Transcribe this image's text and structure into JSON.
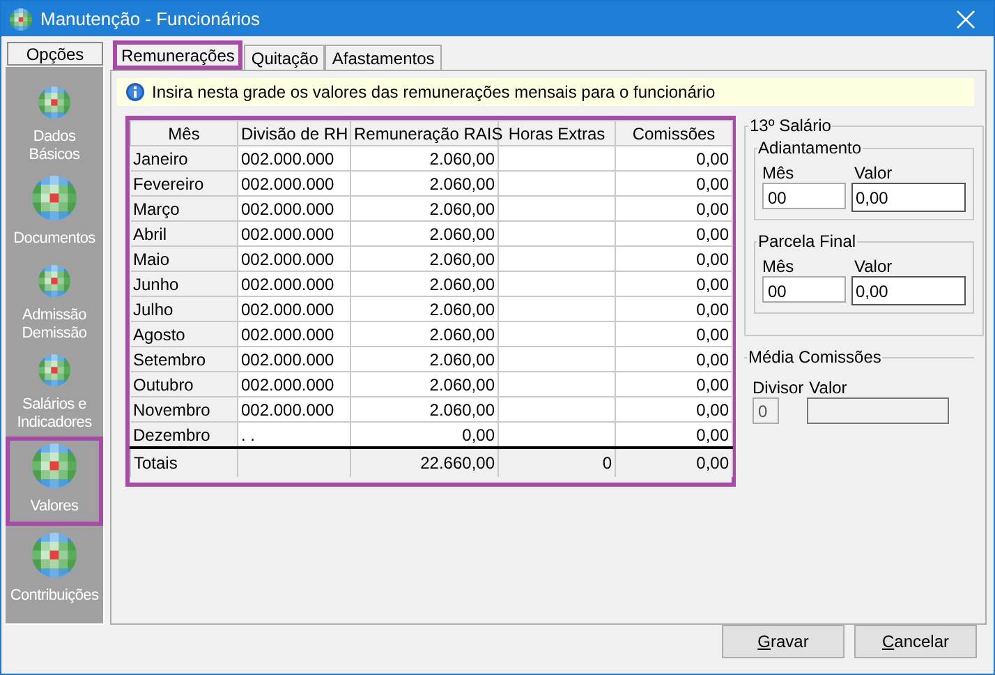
{
  "window": {
    "title": "Manutenção - Funcionários"
  },
  "sidebar": {
    "header": "Opções",
    "items": [
      {
        "label": "Dados Básicos",
        "selected": false
      },
      {
        "label": "Documentos",
        "selected": false
      },
      {
        "label": "Admissão Demissão",
        "selected": false
      },
      {
        "label": "Salários e Indicadores",
        "selected": false
      },
      {
        "label": "Valores",
        "selected": true
      },
      {
        "label": "Contribuições",
        "selected": false
      }
    ]
  },
  "tabs": [
    {
      "label": "Remunerações",
      "selected": true
    },
    {
      "label": "Quitação",
      "selected": false
    },
    {
      "label": "Afastamentos",
      "selected": false
    }
  ],
  "info": "Insira nesta grade os valores das remunerações mensais para o funcionário",
  "table": {
    "highlighted": true,
    "columns": [
      "Mês",
      "Divisão de RH",
      "Remuneração RAIS",
      "Horas Extras",
      "Comissões"
    ],
    "rows": [
      {
        "mes": "Janeiro",
        "divisao": "002.000.000",
        "remuneracao": "2.060,00",
        "comissoes": "0,00"
      },
      {
        "mes": "Fevereiro",
        "divisao": "002.000.000",
        "remuneracao": "2.060,00",
        "comissoes": "0,00"
      },
      {
        "mes": "Março",
        "divisao": "002.000.000",
        "remuneracao": "2.060,00",
        "comissoes": "0,00"
      },
      {
        "mes": "Abril",
        "divisao": "002.000.000",
        "remuneracao": "2.060,00",
        "comissoes": "0,00"
      },
      {
        "mes": "Maio",
        "divisao": "002.000.000",
        "remuneracao": "2.060,00",
        "comissoes": "0,00"
      },
      {
        "mes": "Junho",
        "divisao": "002.000.000",
        "remuneracao": "2.060,00",
        "comissoes": "0,00"
      },
      {
        "mes": "Julho",
        "divisao": "002.000.000",
        "remuneracao": "2.060,00",
        "comissoes": "0,00"
      },
      {
        "mes": "Agosto",
        "divisao": "002.000.000",
        "remuneracao": "2.060,00",
        "comissoes": "0,00"
      },
      {
        "mes": "Setembro",
        "divisao": "002.000.000",
        "remuneracao": "2.060,00",
        "comissoes": "0,00"
      },
      {
        "mes": "Outubro",
        "divisao": "002.000.000",
        "remuneracao": "2.060,00",
        "comissoes": "0,00"
      },
      {
        "mes": "Novembro",
        "divisao": "002.000.000",
        "remuneracao": "2.060,00",
        "comissoes": "0,00"
      },
      {
        "mes": "Dezembro",
        "divisao": ". .",
        "remuneracao": "0,00",
        "comissoes": "0,00"
      }
    ],
    "totals": {
      "label": "Totais",
      "remuneracao": "22.660,00",
      "horas_extras": "0",
      "comissoes": "0,00"
    }
  },
  "decimo_terceiro": {
    "title": "13º Salário",
    "groups": [
      {
        "title": "Adiantamento",
        "mes_label": "Mês",
        "mes": "00",
        "valor_label": "Valor",
        "valor": "0,00"
      },
      {
        "title": "Parcela Final",
        "mes_label": "Mês",
        "mes": "00",
        "valor_label": "Valor",
        "valor": "0,00"
      }
    ]
  },
  "media_comissoes": {
    "title": "Média Comissões",
    "divisor_label": "Divisor",
    "divisor": "0",
    "valor_label": "Valor"
  },
  "buttons": [
    {
      "label": "Gravar",
      "underline_first": true
    },
    {
      "label": "Cancelar",
      "underline_first": true
    }
  ]
}
